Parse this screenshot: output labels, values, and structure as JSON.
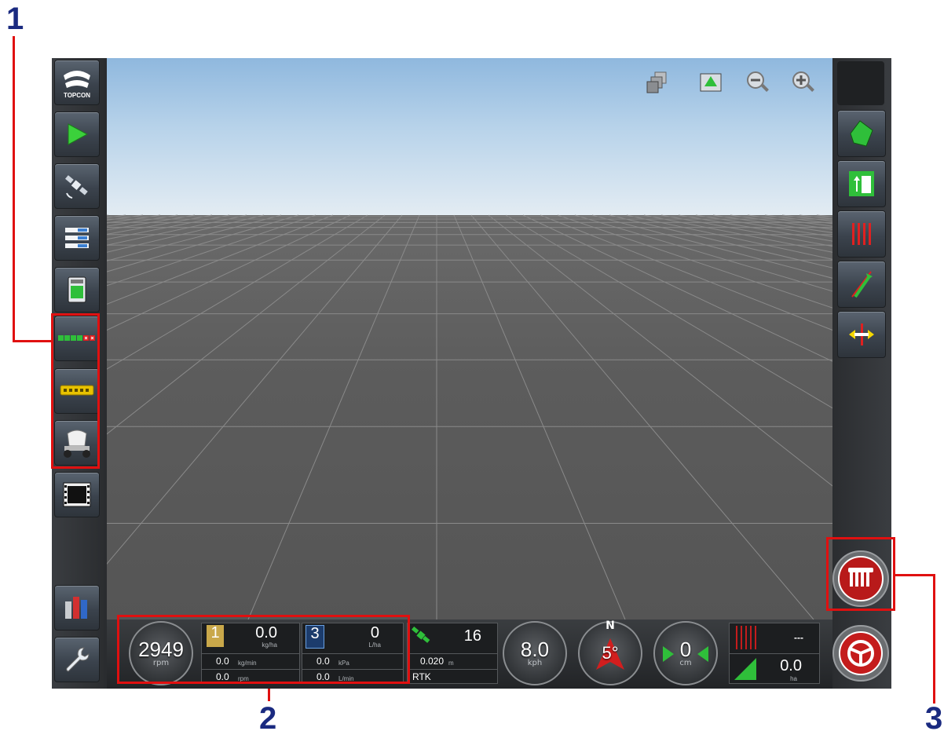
{
  "callouts": {
    "one": "1",
    "two": "2",
    "three": "3"
  },
  "left_toolbar": {
    "items": [
      {
        "name": "topcon-logo",
        "label": "TOPCON"
      },
      {
        "name": "guidance-icon"
      },
      {
        "name": "gps-satellite-icon"
      },
      {
        "name": "settings-list-icon"
      },
      {
        "name": "console-icon"
      },
      {
        "name": "section-control-icon"
      },
      {
        "name": "implement-icon"
      },
      {
        "name": "tank-icon"
      },
      {
        "name": "video-icon"
      },
      {
        "name": "reports-icon"
      },
      {
        "name": "tools-wrench-icon"
      }
    ]
  },
  "view_controls": [
    "layers-icon",
    "field-view-icon",
    "zoom-out-icon",
    "zoom-in-icon"
  ],
  "right_toolbar": [
    "field-boundary-icon",
    "headland-icon",
    "guidance-lines-icon",
    "steering-icon",
    "nudge-icon",
    "auto-section-button",
    "auto-steer-button"
  ],
  "status_bar": {
    "engine_rpm": "2949",
    "engine_rpm_unit": "rpm",
    "product1": {
      "channel": "1",
      "rate": "0.0",
      "rate_unit": "kg/ha",
      "flow": "0.0",
      "flow_unit": "kg/min",
      "speed": "0.0",
      "speed_unit": "rpm"
    },
    "product3": {
      "channel": "3",
      "rate": "0",
      "rate_unit": "L/ha",
      "pressure": "0.0",
      "pressure_unit": "kPa",
      "flow": "0.0",
      "flow_unit": "L/min"
    },
    "gps": {
      "satellites": "16",
      "accuracy": "0.020",
      "accuracy_unit": "m",
      "mode": "RTK"
    },
    "speed": {
      "value": "8.0",
      "unit": "kph"
    },
    "heading": {
      "value": "5°",
      "north": "N"
    },
    "cross_track": {
      "value": "0",
      "unit": "cm"
    },
    "sections": {
      "status": "---"
    },
    "area": {
      "value": "0.0",
      "unit": "ha"
    }
  },
  "colors": {
    "highlight": "#e01010",
    "callout_text": "#1a2a80",
    "green": "#2fbf3a"
  }
}
